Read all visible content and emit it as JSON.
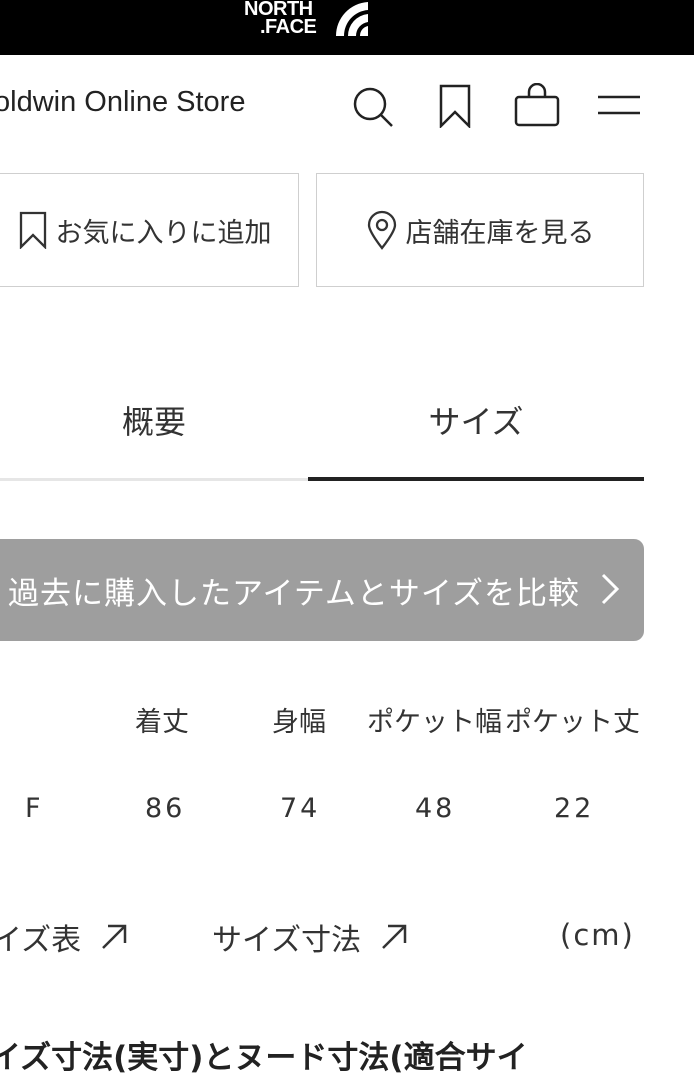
{
  "header": {
    "logo_line1": "NORTH",
    "logo_line2": ".FACE",
    "store_name": "oldwin Online Store",
    "icons": [
      "search-icon",
      "bookmark-icon",
      "cart-icon",
      "menu-icon"
    ]
  },
  "actions": {
    "favorite_label": "お気に入りに追加",
    "store_stock_label": "店舗在庫を見る"
  },
  "tabs": [
    {
      "label": "概要",
      "active": false
    },
    {
      "label": "サイズ",
      "active": true
    }
  ],
  "compare_button": {
    "label": "過去に購入したアイテムとサイズを比較"
  },
  "size_table": {
    "headers": [
      "着丈",
      "身幅",
      "ポケット幅",
      "ポケット丈"
    ],
    "rows": [
      {
        "size": "F",
        "values": [
          "86",
          "74",
          "48",
          "22"
        ]
      }
    ]
  },
  "links": {
    "size_chart": "イズ表",
    "size_dimensions": "サイズ寸法",
    "unit": "(cm)"
  },
  "section_heading": "イズ寸法(実寸)とヌード寸法(適合サイ",
  "colors": {
    "topbar": "#000000",
    "text": "#222222",
    "compare_bg": "#9e9e9e",
    "border": "#cfcfcf"
  }
}
